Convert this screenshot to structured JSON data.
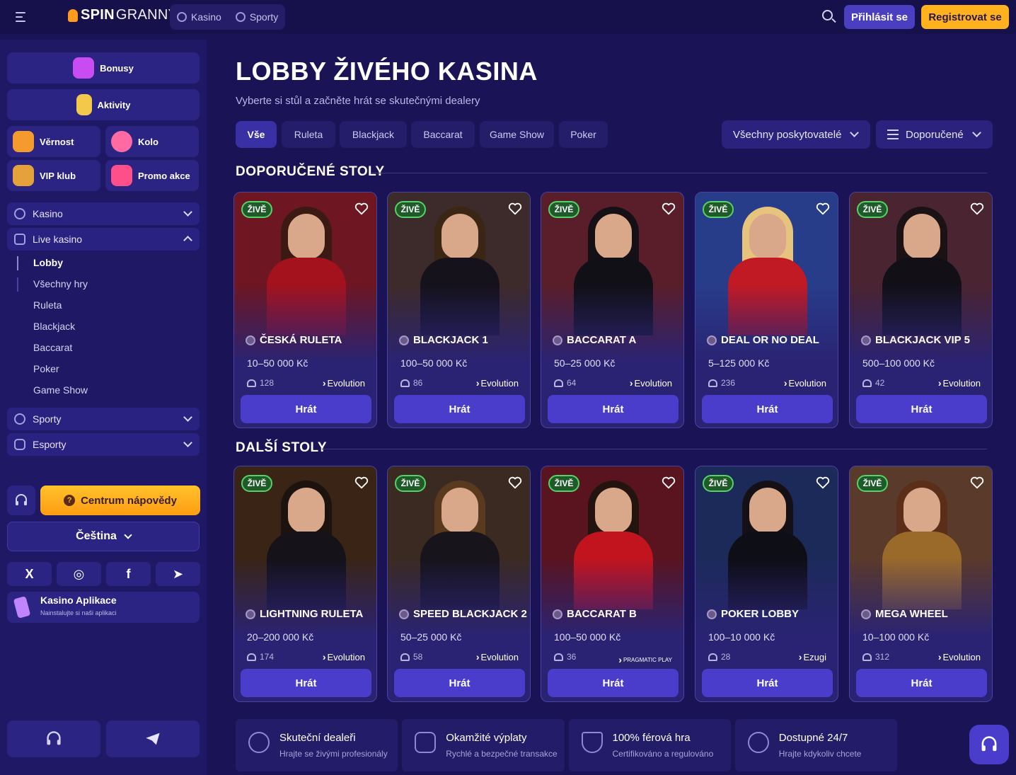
{
  "topbar": {
    "logo_spin": "SPIN",
    "logo_granny": "GRANNY",
    "nav": [
      {
        "label": "Kasino",
        "icon": "casino-chip-icon"
      },
      {
        "label": "Sporty",
        "icon": "soccer-ball-icon"
      }
    ],
    "login_label": "Přihlásit se",
    "register_label": "Registrovat se"
  },
  "sidebar": {
    "promo_wide": [
      {
        "label": "Bonusy",
        "icon": "bonus-icon",
        "color": "#c94bf2"
      },
      {
        "label": "Aktivity",
        "icon": "clipboard-icon",
        "color": "#f2c94b"
      }
    ],
    "promo_half": [
      {
        "label": "Věrnost",
        "icon": "loyalty-icon",
        "color": "#f59b2d"
      },
      {
        "label": "Kolo",
        "icon": "wheel-icon",
        "color": "#ff6aa2"
      },
      {
        "label": "VIP klub",
        "icon": "vip-icon",
        "color": "#e6a23a"
      },
      {
        "label": "Promo akce",
        "icon": "promo-icon",
        "color": "#ff4f8b"
      }
    ],
    "menu": {
      "kasino": "Kasino",
      "live_kasino": "Live kasino",
      "sub": [
        "Lobby",
        "Všechny hry",
        "Ruleta",
        "Blackjack",
        "Baccarat",
        "Poker",
        "Game Show"
      ],
      "sporty": "Sporty",
      "esporty": "Esporty"
    },
    "help_label": "Centrum nápovědy",
    "help_mark": "?",
    "language_label": "Čeština",
    "social": [
      {
        "icon": "x-icon",
        "glyph": "X"
      },
      {
        "icon": "instagram-icon",
        "glyph": "◎"
      },
      {
        "icon": "facebook-icon",
        "glyph": "f"
      },
      {
        "icon": "telegram-icon",
        "glyph": "➤"
      }
    ],
    "app_title": "Kasino Aplikace",
    "app_subtitle": "Nainstalujte si naši aplikaci"
  },
  "main": {
    "title": "LOBBY ŽIVÉHO KASINA",
    "subtitle": "Vyberte si stůl a začněte hrát se skutečnými dealery",
    "tabs": [
      "Vše",
      "Ruleta",
      "Blackjack",
      "Baccarat",
      "Game Show",
      "Poker"
    ],
    "active_tab": "Vše",
    "provider_select": "Všechny poskytovatelé",
    "sort_select": "Doporučené",
    "section_featured": "DOPORUČENÉ STOLY",
    "section_more": "DALŠÍ STOLY",
    "live_label": "ŽIVĚ",
    "play_label": "Hrát",
    "featured_tables": [
      {
        "name": "ČESKÁ RULETA",
        "limits": "10–50 000 Kč",
        "players": "128",
        "provider": "Evolution",
        "bg": "#6e1622",
        "outfit": "#a3121d",
        "hair": "#3a1a12"
      },
      {
        "name": "BLACKJACK 1",
        "limits": "100–50 000 Kč",
        "players": "86",
        "provider": "Evolution",
        "bg": "#3d2a2a",
        "outfit": "#15121c",
        "hair": "#3b2616"
      },
      {
        "name": "BACCARAT A",
        "limits": "50–25 000 Kč",
        "players": "64",
        "provider": "Evolution",
        "bg": "#5a1e2a",
        "outfit": "#111016",
        "hair": "#151015"
      },
      {
        "name": "DEAL OR NO DEAL",
        "limits": "5–125 000 Kč",
        "players": "236",
        "provider": "Evolution",
        "bg": "#283d8a",
        "outfit": "#c21a24",
        "hair": "#e6c47e"
      },
      {
        "name": "BLACKJACK VIP 5",
        "limits": "500–100 000 Kč",
        "players": "42",
        "provider": "Evolution",
        "bg": "#4a2430",
        "outfit": "#121016",
        "hair": "#1a1214"
      }
    ],
    "more_tables": [
      {
        "name": "LIGHTNING RULETA",
        "limits": "20–200 000 Kč",
        "players": "174",
        "provider": "Evolution",
        "bg": "#3a2416",
        "outfit": "#15121a",
        "hair": "#1c120e"
      },
      {
        "name": "SPEED BLACKJACK 2",
        "limits": "50–25 000 Kč",
        "players": "58",
        "provider": "Evolution",
        "bg": "#3b2a22",
        "outfit": "#17141c",
        "hair": "#5a3a1e"
      },
      {
        "name": "BACCARAT B",
        "limits": "100–50 000 Kč",
        "players": "36",
        "provider": "PRAGMATIC PLAY",
        "bg": "#5a1420",
        "outfit": "#c2141e",
        "hair": "#241410"
      },
      {
        "name": "POKER LOBBY",
        "limits": "100–10 000 Kč",
        "players": "28",
        "provider": "Ezugi",
        "bg": "#1c2a5a",
        "outfit": "#0e0e16",
        "hair": "#141016"
      },
      {
        "name": "MEGA WHEEL",
        "limits": "10–100 000 Kč",
        "players": "312",
        "provider": "Evolution",
        "bg": "#5a3a2a",
        "outfit": "#9a6a2a",
        "hair": "#5a2e18"
      }
    ],
    "features": [
      {
        "title": "Skuteční dealeři",
        "subtitle": "Hrajte se živými profesionály",
        "icon": "dealers-icon"
      },
      {
        "title": "Okamžité výplaty",
        "subtitle": "Rychlé a bezpečné transakce",
        "icon": "wallet-icon"
      },
      {
        "title": "100% férová hra",
        "subtitle": "Certifikováno a regulováno",
        "icon": "shield-icon"
      },
      {
        "title": "Dostupné 24/7",
        "subtitle": "Hrajte kdykoliv chcete",
        "icon": "clock-icon"
      }
    ]
  }
}
